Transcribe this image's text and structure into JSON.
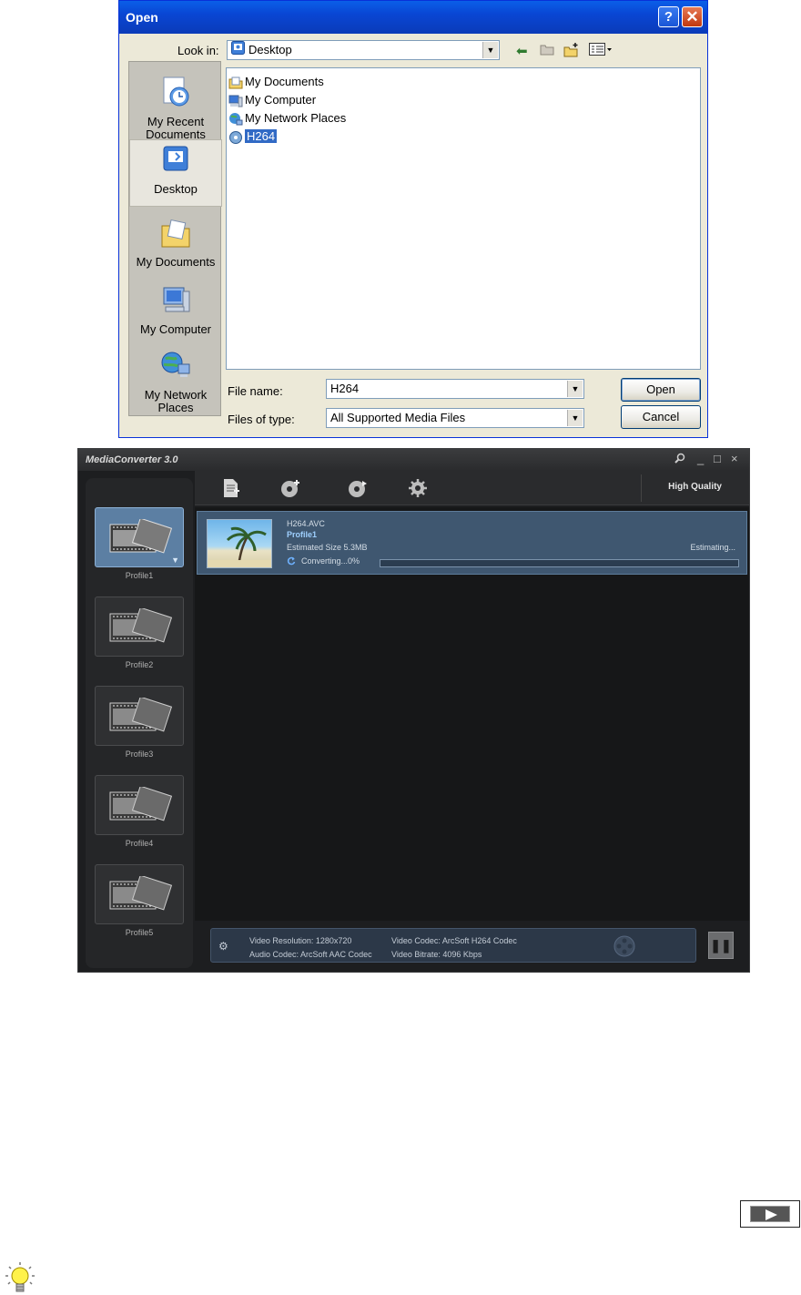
{
  "open_dialog": {
    "title": "Open",
    "help_glyph": "?",
    "close_glyph": "✕",
    "look_in_label": "Look in:",
    "look_in_value": "Desktop",
    "places": [
      {
        "label": "My Recent Documents",
        "icon": "recent-documents-icon"
      },
      {
        "label": "Desktop",
        "icon": "desktop-icon",
        "selected": true
      },
      {
        "label": "My Documents",
        "icon": "my-documents-icon"
      },
      {
        "label": "My Computer",
        "icon": "my-computer-icon"
      },
      {
        "label": "My Network Places",
        "icon": "network-places-icon"
      }
    ],
    "files": [
      {
        "name": "My Documents",
        "icon": "folder-icon"
      },
      {
        "name": "My Computer",
        "icon": "computer-icon"
      },
      {
        "name": "My Network Places",
        "icon": "network-icon"
      },
      {
        "name": "H264",
        "icon": "media-file-icon",
        "selected": true
      }
    ],
    "file_name_label": "File name:",
    "file_name_value": "H264",
    "files_of_type_label": "Files of type:",
    "files_of_type_value": "All Supported Media Files",
    "open_button": "Open",
    "cancel_button": "Cancel"
  },
  "media_converter": {
    "title": "MediaConverter 3.0",
    "quality": "High Quality",
    "profiles": [
      "Profile1",
      "Profile2",
      "Profile3",
      "Profile4",
      "Profile5"
    ],
    "job": {
      "filename": "H264.AVC",
      "profile": "Profile1",
      "estimated_size": "Estimated Size 5.3MB",
      "status": "Converting...0%",
      "right_status": "Estimating...",
      "progress_percent": 0
    },
    "info": {
      "video_resolution": "Video Resolution: 1280x720",
      "audio_codec": "Audio Codec: ArcSoft AAC Codec",
      "video_codec": "Video Codec: ArcSoft H264 Codec",
      "video_bitrate": "Video Bitrate: 4096 Kbps"
    }
  }
}
